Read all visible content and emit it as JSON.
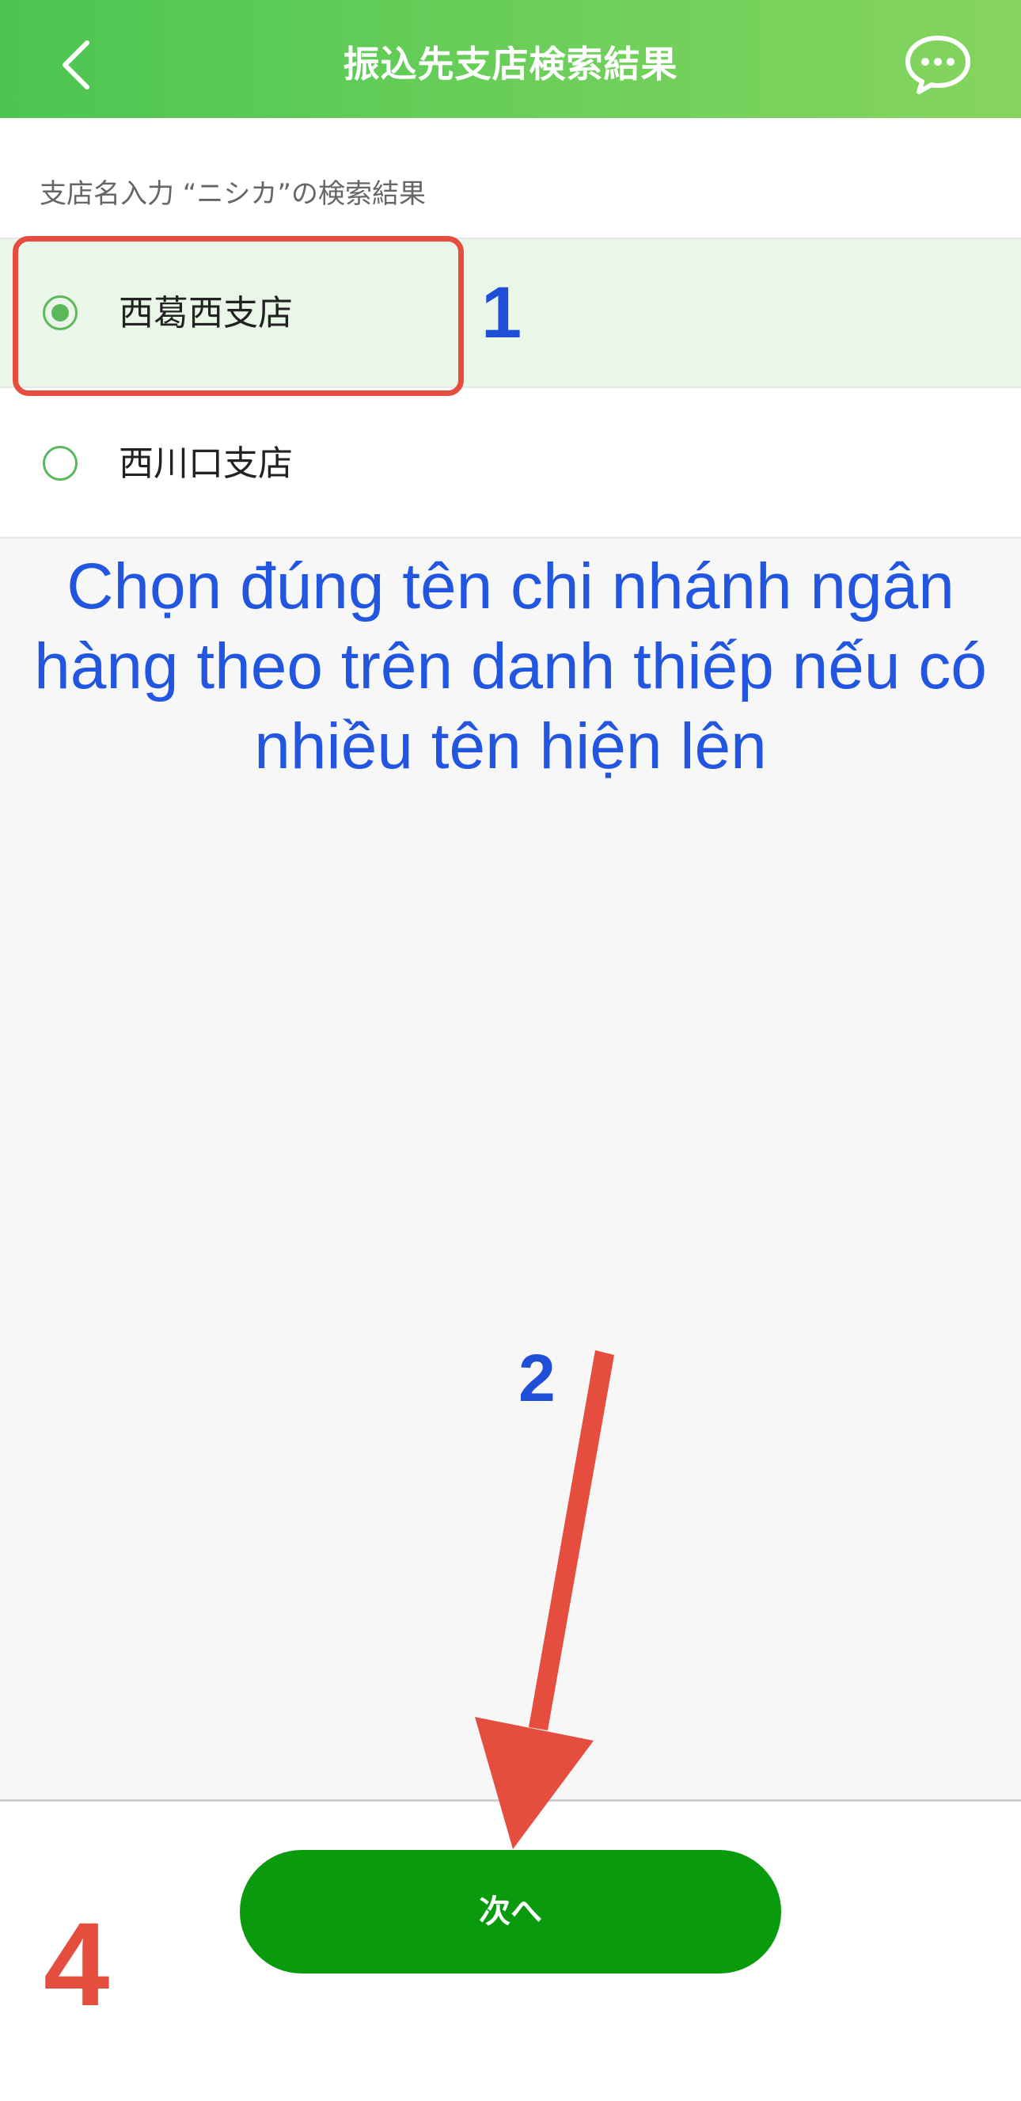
{
  "header": {
    "title": "振込先支店検索結果",
    "back_icon": "chevron-left-icon",
    "chat_icon": "chat-bubble-icon"
  },
  "search": {
    "caption": "支店名入力 “ニシカ”の検索結果"
  },
  "branches": [
    {
      "label": "西葛西支店",
      "selected": true
    },
    {
      "label": "西川口支店",
      "selected": false
    }
  ],
  "annotations": {
    "step_1": "1",
    "step_2": "2",
    "step_4": "4",
    "instruction": "Chọn đúng tên chi nhánh ngân hàng theo trên danh thiếp nếu có nhiều tên hiện lên"
  },
  "footer": {
    "next_label": "次へ"
  },
  "colors": {
    "header_gradient_start": "#4cc552",
    "header_gradient_end": "#86d45f",
    "selected_row": "#eaf6e8",
    "radio": "#5cb85c",
    "next_button": "#0a9a0e",
    "annotation_red": "#e54d3f",
    "annotation_blue": "#2255e0"
  }
}
